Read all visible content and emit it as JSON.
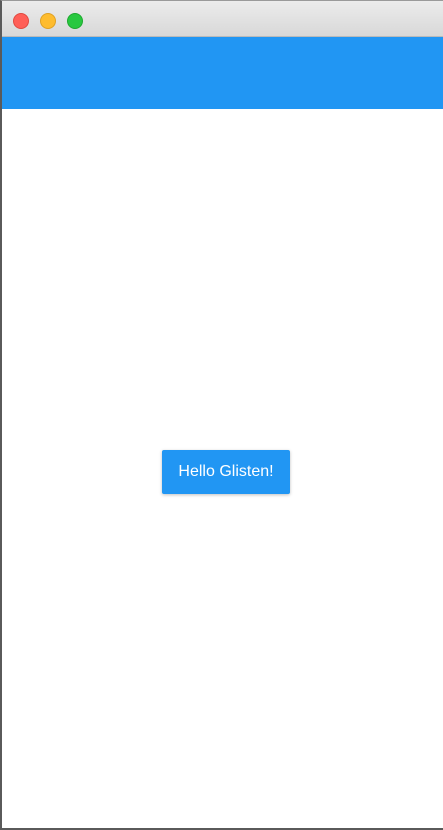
{
  "window": {
    "controls": [
      {
        "name": "close",
        "color": "#ff5f57"
      },
      {
        "name": "minimize",
        "color": "#febc2e"
      },
      {
        "name": "maximize",
        "color": "#28c840"
      }
    ]
  },
  "appbar": {
    "color": "#2196f3"
  },
  "main": {
    "button_label": "Hello Glisten!",
    "button_color": "#2196f3"
  }
}
